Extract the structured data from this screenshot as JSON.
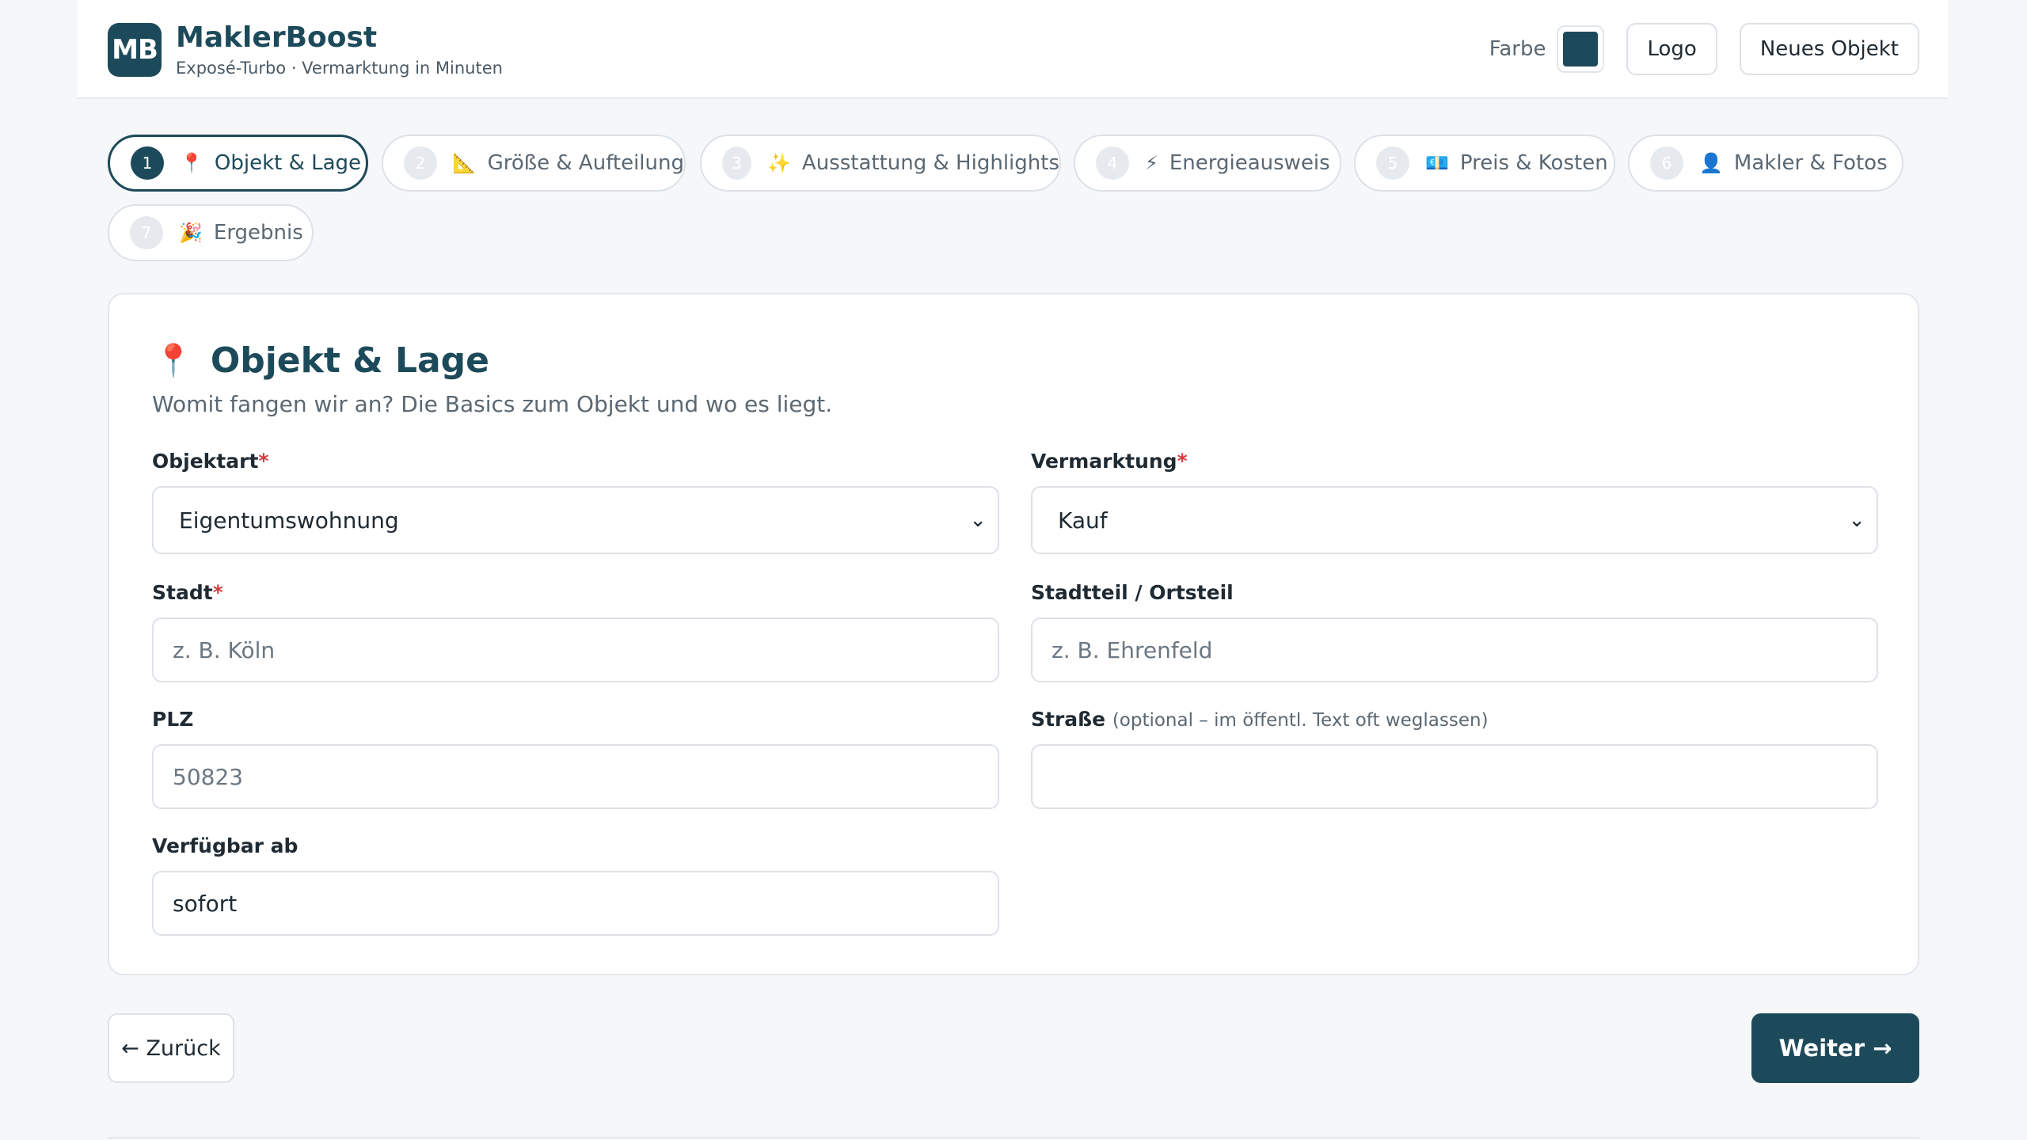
{
  "brand": {
    "logo_text": "MB",
    "name": "MaklerBoost",
    "tagline": "Exposé-Turbo · Vermarktung in Minuten"
  },
  "header": {
    "color_label": "Farbe",
    "color_value": "#1d4a5a",
    "logo_button": "Logo",
    "new_object_button": "Neues Objekt"
  },
  "steps": [
    {
      "num": "1",
      "icon": "pin-icon",
      "glyph": "📍",
      "label": "Objekt & Lage",
      "active": true
    },
    {
      "num": "2",
      "icon": "ruler-icon",
      "glyph": "📐",
      "label": "Größe & Aufteilung",
      "active": false
    },
    {
      "num": "3",
      "icon": "sparkles-icon",
      "glyph": "✨",
      "label": "Ausstattung & Highlights",
      "active": false
    },
    {
      "num": "4",
      "icon": "lightning-icon",
      "glyph": "⚡",
      "label": "Energieausweis",
      "active": false
    },
    {
      "num": "5",
      "icon": "money-icon",
      "glyph": "💶",
      "label": "Preis & Kosten",
      "active": false
    },
    {
      "num": "6",
      "icon": "person-icon",
      "glyph": "👤",
      "label": "Makler & Fotos",
      "active": false
    },
    {
      "num": "7",
      "icon": "party-icon",
      "glyph": "🎉",
      "label": "Ergebnis",
      "active": false
    }
  ],
  "section": {
    "icon": "pin-icon",
    "glyph": "📍",
    "title": "Objekt & Lage",
    "subtitle": "Womit fangen wir an? Die Basics zum Objekt und wo es liegt."
  },
  "form": {
    "objektart": {
      "label": "Objektart",
      "required": "*",
      "value": "Eigentumswohnung"
    },
    "vermarktung": {
      "label": "Vermarktung",
      "required": "*",
      "value": "Kauf"
    },
    "stadt": {
      "label": "Stadt",
      "required": "*",
      "placeholder": "z. B. Köln"
    },
    "stadtteil": {
      "label": "Stadtteil / Ortsteil",
      "placeholder": "z. B. Ehrenfeld"
    },
    "plz": {
      "label": "PLZ",
      "placeholder": "50823"
    },
    "strasse": {
      "label": "Straße",
      "hint": "(optional – im öffentl. Text oft weglassen)",
      "value": ""
    },
    "verfuegbar": {
      "label": "Verfügbar ab",
      "value": "sofort"
    }
  },
  "nav": {
    "back": "← Zurück",
    "next": "Weiter →"
  }
}
